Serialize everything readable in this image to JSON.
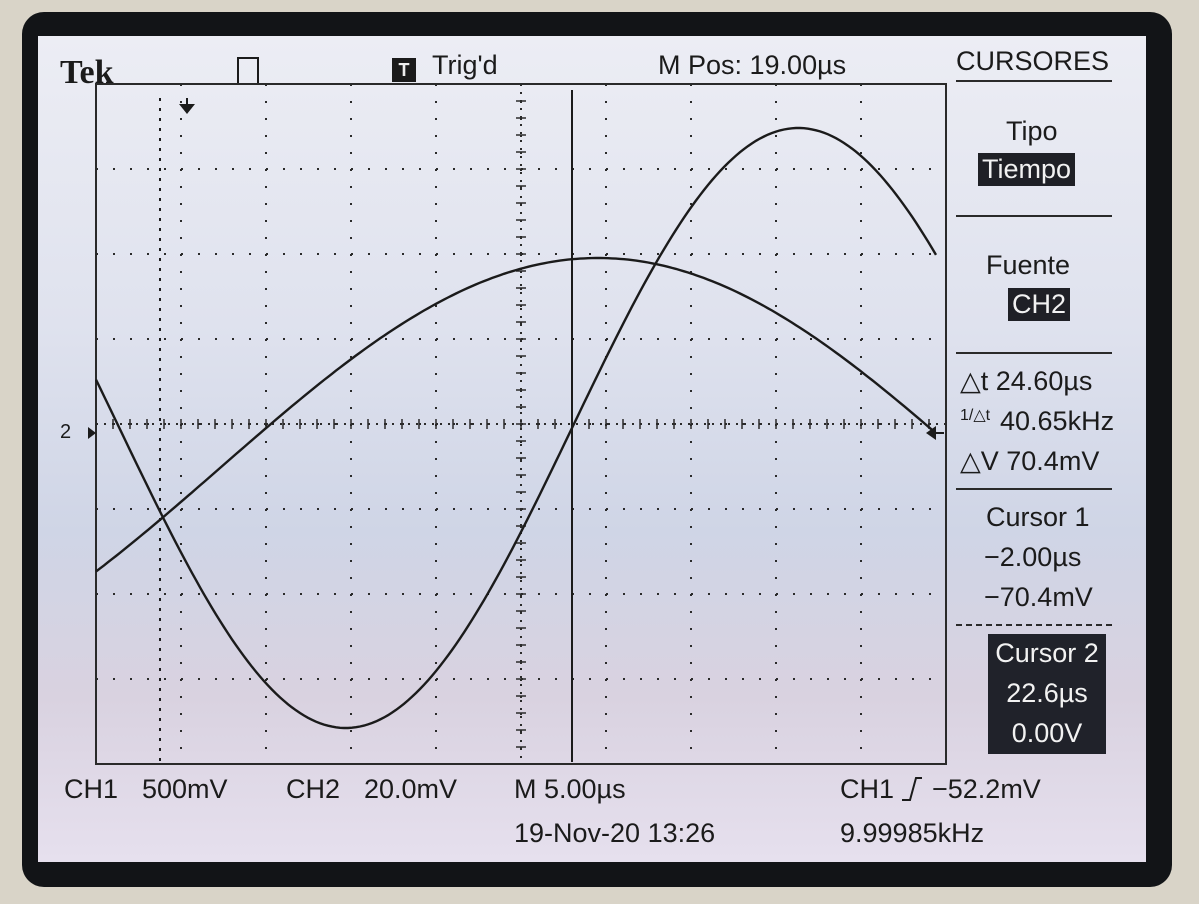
{
  "header": {
    "brand": "Tek",
    "trigger_letter": "T",
    "trigger_status": "Trig'd",
    "main_position": "M Pos: 19.00µs"
  },
  "menu": {
    "title": "CURSORES",
    "tipo": {
      "label": "Tipo",
      "value": "Tiempo"
    },
    "fuente": {
      "label": "Fuente",
      "value": "CH2"
    },
    "delta_t": "△t 24.60µs",
    "inv_delta_t_label": "1/△t",
    "inv_delta_t": "40.65kHz",
    "delta_v": "△V 70.4mV",
    "cursor1": {
      "label": "Cursor 1",
      "time": "−2.00µs",
      "volt": "−70.4mV"
    },
    "cursor2": {
      "label": "Cursor 2",
      "time": "22.6µs",
      "volt": "0.00V"
    }
  },
  "footer": {
    "ch1_label": "CH1",
    "ch1_scale": "500mV",
    "ch2_label": "CH2",
    "ch2_scale": "20.0mV",
    "timebase": "M 5.00µs",
    "trigger_source": "CH1",
    "trigger_level": "−52.2mV",
    "datetime": "19-Nov-20 13:26",
    "frequency": "9.99985kHz"
  },
  "markers": {
    "ch2_ground": "2"
  },
  "colors": {
    "screen": "#e4e6f0",
    "trace": "#1b1b1b",
    "highlight": "#1f2026"
  }
}
